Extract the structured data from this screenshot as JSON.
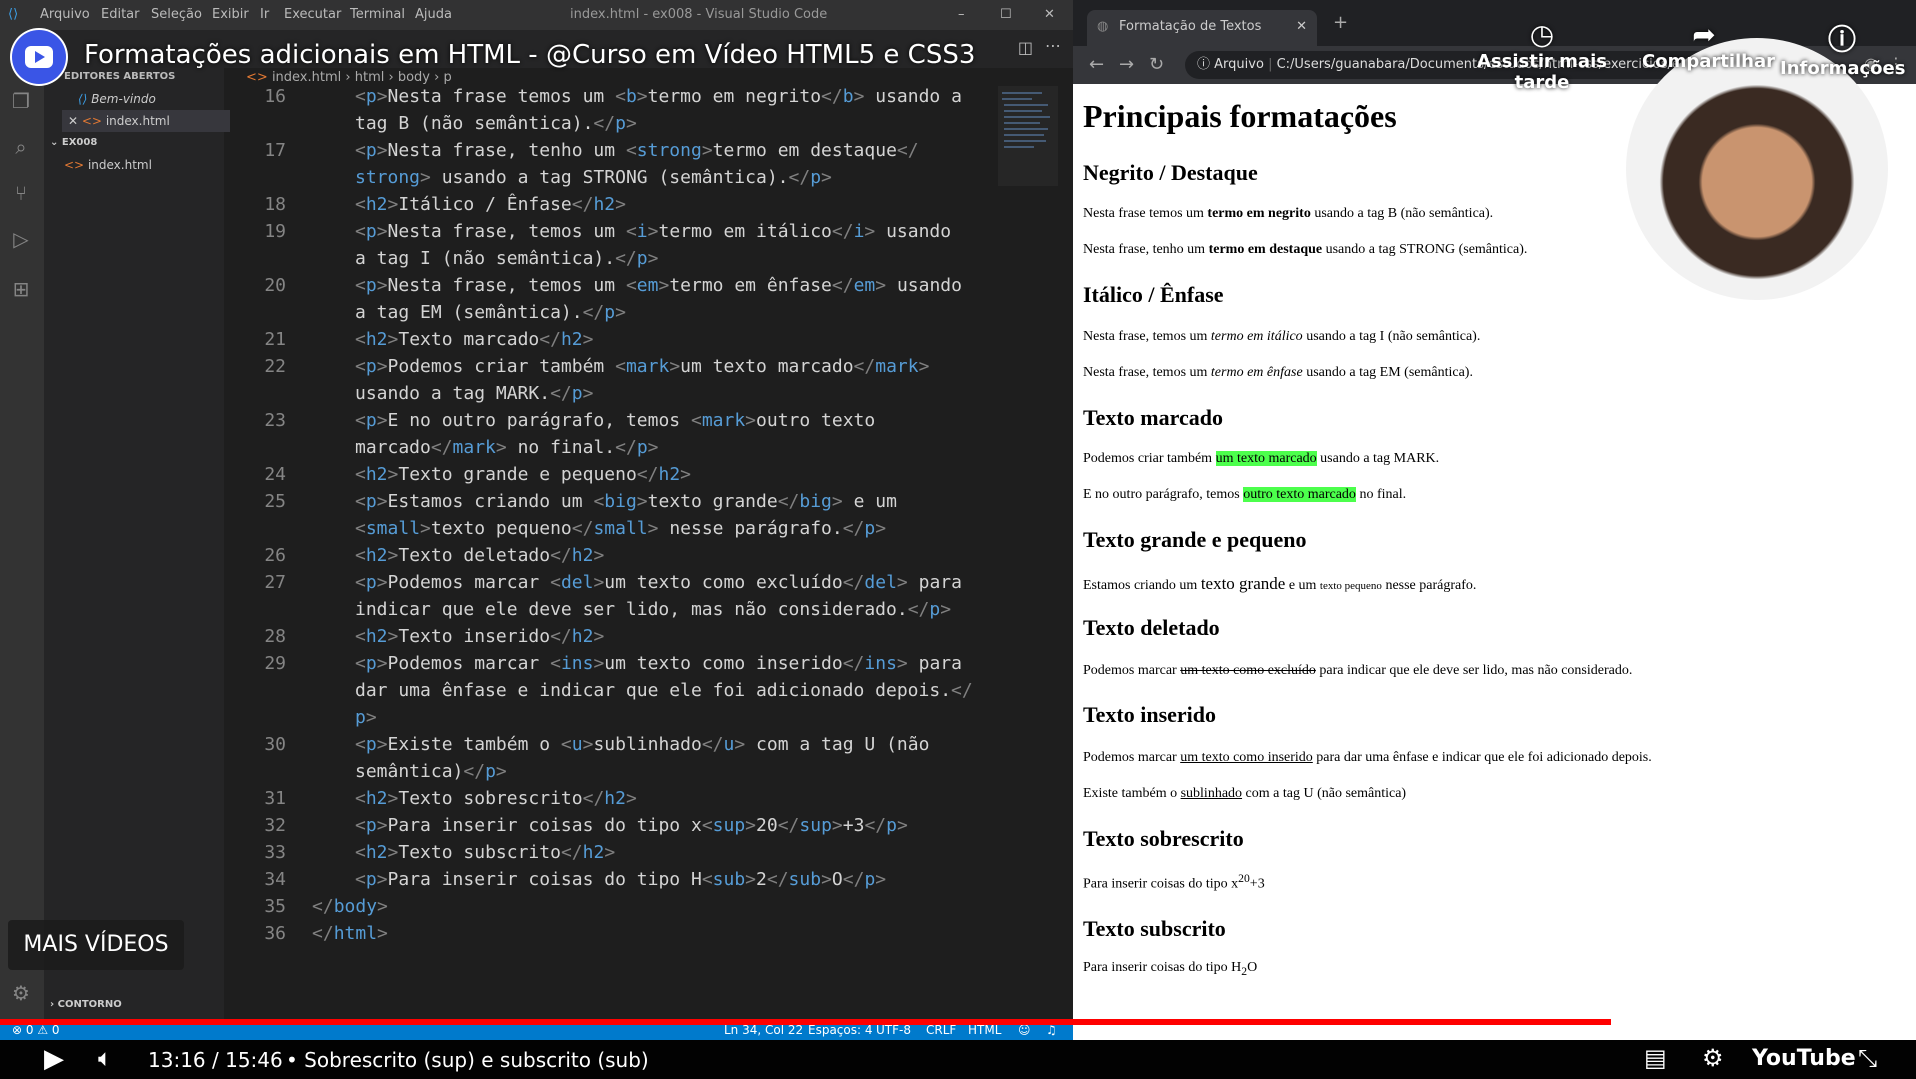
{
  "video": {
    "title": "Formatações adicionais em HTML - @Curso em Vídeo HTML5 e CSS3",
    "time": "13:16 / 15:46",
    "chapter": "• Sobrescrito (sup) e subscrito (sub)",
    "progress": 0.841,
    "mais_videos": "MAIS VÍDEOS",
    "top_buttons": [
      "Assistir mais tarde",
      "Compartilhar",
      "Informações"
    ]
  },
  "vscode": {
    "title": "index.html - ex008 - Visual Studio Code",
    "menu": [
      "Arquivo",
      "Editar",
      "Seleção",
      "Exibir",
      "Ir",
      "Executar",
      "Terminal",
      "Ajuda"
    ],
    "sidebar": {
      "open_editors_label": "EDITORES ABERTOS",
      "open_editors": [
        "Bem-vindo",
        "index.html"
      ],
      "folder": "EX008",
      "files": [
        "index.html"
      ],
      "outline": "CONTORNO"
    },
    "breadcrumb": [
      "index.html",
      "html",
      "body",
      "p"
    ],
    "status": {
      "problems": "⊗ 0 ⚠ 0",
      "position": "Ln 34, Col 22",
      "spaces": "Espaços: 4",
      "encoding": "UTF-8",
      "eol": "CRLF",
      "lang": "HTML"
    },
    "lines": [
      {
        "n": "16",
        "html": "<span class='br'>&lt;</span><span class='tg'>p</span><span class='br'>&gt;</span>Nesta frase temos um <span class='br'>&lt;</span><span class='tg'>b</span><span class='br'>&gt;</span>termo em negrito<span class='br'>&lt;/</span><span class='tg'>b</span><span class='br'>&gt;</span> usando a"
      },
      {
        "n": "",
        "html": "tag B (não semântica).<span class='br'>&lt;/</span><span class='tg'>p</span><span class='br'>&gt;</span>"
      },
      {
        "n": "17",
        "html": "<span class='br'>&lt;</span><span class='tg'>p</span><span class='br'>&gt;</span>Nesta frase, tenho um <span class='br'>&lt;</span><span class='tg'>strong</span><span class='br'>&gt;</span>termo em destaque<span class='br'>&lt;/</span>"
      },
      {
        "n": "",
        "html": "<span class='tg'>strong</span><span class='br'>&gt;</span> usando a tag STRONG (semântica).<span class='br'>&lt;/</span><span class='tg'>p</span><span class='br'>&gt;</span>"
      },
      {
        "n": "18",
        "html": "<span class='br'>&lt;</span><span class='tg'>h2</span><span class='br'>&gt;</span>Itálico / Ênfase<span class='br'>&lt;/</span><span class='tg'>h2</span><span class='br'>&gt;</span>"
      },
      {
        "n": "19",
        "html": "<span class='br'>&lt;</span><span class='tg'>p</span><span class='br'>&gt;</span>Nesta frase, temos um <span class='br'>&lt;</span><span class='tg'>i</span><span class='br'>&gt;</span>termo em itálico<span class='br'>&lt;/</span><span class='tg'>i</span><span class='br'>&gt;</span> usando"
      },
      {
        "n": "",
        "html": "a tag I (não semântica).<span class='br'>&lt;/</span><span class='tg'>p</span><span class='br'>&gt;</span>"
      },
      {
        "n": "20",
        "html": "<span class='br'>&lt;</span><span class='tg'>p</span><span class='br'>&gt;</span>Nesta frase, temos um <span class='br'>&lt;</span><span class='tg'>em</span><span class='br'>&gt;</span>termo em ênfase<span class='br'>&lt;/</span><span class='tg'>em</span><span class='br'>&gt;</span> usando"
      },
      {
        "n": "",
        "html": "a tag EM (semântica).<span class='br'>&lt;/</span><span class='tg'>p</span><span class='br'>&gt;</span>"
      },
      {
        "n": "21",
        "html": "<span class='br'>&lt;</span><span class='tg'>h2</span><span class='br'>&gt;</span>Texto marcado<span class='br'>&lt;/</span><span class='tg'>h2</span><span class='br'>&gt;</span>"
      },
      {
        "n": "22",
        "html": "<span class='br'>&lt;</span><span class='tg'>p</span><span class='br'>&gt;</span>Podemos criar também <span class='br'>&lt;</span><span class='tg'>mark</span><span class='br'>&gt;</span>um texto marcado<span class='br'>&lt;/</span><span class='tg'>mark</span><span class='br'>&gt;</span>"
      },
      {
        "n": "",
        "html": "usando a tag MARK.<span class='br'>&lt;/</span><span class='tg'>p</span><span class='br'>&gt;</span>"
      },
      {
        "n": "23",
        "html": "<span class='br'>&lt;</span><span class='tg'>p</span><span class='br'>&gt;</span>E no outro parágrafo, temos <span class='br'>&lt;</span><span class='tg'>mark</span><span class='br'>&gt;</span>outro texto"
      },
      {
        "n": "",
        "html": "marcado<span class='br'>&lt;/</span><span class='tg'>mark</span><span class='br'>&gt;</span> no final.<span class='br'>&lt;/</span><span class='tg'>p</span><span class='br'>&gt;</span>"
      },
      {
        "n": "24",
        "html": "<span class='br'>&lt;</span><span class='tg'>h2</span><span class='br'>&gt;</span>Texto grande e pequeno<span class='br'>&lt;/</span><span class='tg'>h2</span><span class='br'>&gt;</span>"
      },
      {
        "n": "25",
        "html": "<span class='br'>&lt;</span><span class='tg'>p</span><span class='br'>&gt;</span>Estamos criando um <span class='br'>&lt;</span><span class='tg'>big</span><span class='br'>&gt;</span>texto grande<span class='br'>&lt;/</span><span class='tg'>big</span><span class='br'>&gt;</span> e um"
      },
      {
        "n": "",
        "html": "<span class='br'>&lt;</span><span class='tg'>small</span><span class='br'>&gt;</span>texto pequeno<span class='br'>&lt;/</span><span class='tg'>small</span><span class='br'>&gt;</span> nesse parágrafo.<span class='br'>&lt;/</span><span class='tg'>p</span><span class='br'>&gt;</span>"
      },
      {
        "n": "26",
        "html": "<span class='br'>&lt;</span><span class='tg'>h2</span><span class='br'>&gt;</span>Texto deletado<span class='br'>&lt;/</span><span class='tg'>h2</span><span class='br'>&gt;</span>"
      },
      {
        "n": "27",
        "html": "<span class='br'>&lt;</span><span class='tg'>p</span><span class='br'>&gt;</span>Podemos marcar <span class='br'>&lt;</span><span class='tg'>del</span><span class='br'>&gt;</span>um texto como excluído<span class='br'>&lt;/</span><span class='tg'>del</span><span class='br'>&gt;</span> para"
      },
      {
        "n": "",
        "html": "indicar que ele deve ser lido, mas não considerado.<span class='br'>&lt;/</span><span class='tg'>p</span><span class='br'>&gt;</span>"
      },
      {
        "n": "28",
        "html": "<span class='br'>&lt;</span><span class='tg'>h2</span><span class='br'>&gt;</span>Texto inserido<span class='br'>&lt;/</span><span class='tg'>h2</span><span class='br'>&gt;</span>"
      },
      {
        "n": "29",
        "html": "<span class='br'>&lt;</span><span class='tg'>p</span><span class='br'>&gt;</span>Podemos marcar <span class='br'>&lt;</span><span class='tg'>ins</span><span class='br'>&gt;</span>um texto como inserido<span class='br'>&lt;/</span><span class='tg'>ins</span><span class='br'>&gt;</span> para"
      },
      {
        "n": "",
        "html": "dar uma ênfase e indicar que ele foi adicionado depois.<span class='br'>&lt;/</span>"
      },
      {
        "n": "",
        "html": "<span class='tg'>p</span><span class='br'>&gt;</span>"
      },
      {
        "n": "30",
        "html": "<span class='br'>&lt;</span><span class='tg'>p</span><span class='br'>&gt;</span>Existe também o <span class='br'>&lt;</span><span class='tg'>u</span><span class='br'>&gt;</span>sublinhado<span class='br'>&lt;/</span><span class='tg'>u</span><span class='br'>&gt;</span> com a tag U (não"
      },
      {
        "n": "",
        "html": "semântica)<span class='br'>&lt;/</span><span class='tg'>p</span><span class='br'>&gt;</span>"
      },
      {
        "n": "31",
        "html": "<span class='br'>&lt;</span><span class='tg'>h2</span><span class='br'>&gt;</span>Texto sobrescrito<span class='br'>&lt;/</span><span class='tg'>h2</span><span class='br'>&gt;</span>"
      },
      {
        "n": "32",
        "html": "<span class='br'>&lt;</span><span class='tg'>p</span><span class='br'>&gt;</span>Para inserir coisas do tipo x<span class='br'>&lt;</span><span class='tg'>sup</span><span class='br'>&gt;</span>20<span class='br'>&lt;/</span><span class='tg'>sup</span><span class='br'>&gt;</span>+3<span class='br'>&lt;/</span><span class='tg'>p</span><span class='br'>&gt;</span>"
      },
      {
        "n": "33",
        "html": "<span class='br'>&lt;</span><span class='tg'>h2</span><span class='br'>&gt;</span>Texto subscrito<span class='br'>&lt;/</span><span class='tg'>h2</span><span class='br'>&gt;</span>"
      },
      {
        "n": "34",
        "html": "<span class='br'>&lt;</span><span class='tg'>p</span><span class='br'>&gt;</span>Para inserir coisas do tipo H<span class='br'>&lt;</span><span class='tg'>sub</span><span class='br'>&gt;</span>2<span class='br'>&lt;/</span><span class='tg'>sub</span><span class='br'>&gt;</span>O<span class='br'>&lt;/</span><span class='tg'>p</span><span class='br'>&gt;</span>"
      },
      {
        "n": "35",
        "lvl": 0,
        "html": "<span class='br'>&lt;/</span><span class='tg'>body</span><span class='br'>&gt;</span>"
      },
      {
        "n": "36",
        "lvl": 0,
        "html": "<span class='br'>&lt;/</span><span class='tg'>html</span><span class='br'>&gt;</span>"
      }
    ]
  },
  "browser": {
    "tab_title": "Formatação de Textos",
    "url_label": "Arquivo",
    "url": "C:/Users/guanabara/Documents/estudos/html-css/exercicios/ex008",
    "page": {
      "h1": "Principais formatações",
      "sections": [
        {
          "h2": "Negrito / Destaque"
        },
        {
          "h2": "Itálico / Ênfase"
        },
        {
          "h2": "Texto marcado"
        },
        {
          "h2": "Texto grande e pequeno"
        },
        {
          "h2": "Texto deletado"
        },
        {
          "h2": "Texto inserido"
        },
        {
          "h2": "Texto sobrescrito"
        },
        {
          "h2": "Texto subscrito"
        }
      ],
      "paragraphs_html": [
        "Nesta frase temos um <b>termo em negrito</b> usando a tag B (não semântica).",
        "Nesta frase, tenho um <strong>termo em destaque</strong> usando a tag STRONG (semântica).",
        "Nesta frase, temos um <i>termo em itálico</i> usando a tag I (não semântica).",
        "Nesta frase, temos um <em>termo em ênfase</em> usando a tag EM (semântica).",
        "Podemos criar também <mark class='hl'>um texto marcado</mark> usando a tag MARK.",
        "E no outro parágrafo, temos <mark class='hl'>outro texto marcado</mark> no final.",
        "Estamos criando um <big style='font-size:17px'>texto grande</big> e um <small style='font-size:11px'>texto pequeno</small> nesse parágrafo.",
        "Podemos marcar <del>um texto como excluído</del> para indicar que ele deve ser lido, mas não considerado.",
        "Podemos marcar <ins>um texto como inserido</ins> para dar uma ênfase e indicar que ele foi adicionado depois.",
        "Existe também o <u>sublinhado</u> com a tag U (não semântica)",
        "Para inserir coisas do tipo x<sup>20</sup>+3",
        "Para inserir coisas do tipo H<sub>2</sub>O"
      ]
    }
  }
}
